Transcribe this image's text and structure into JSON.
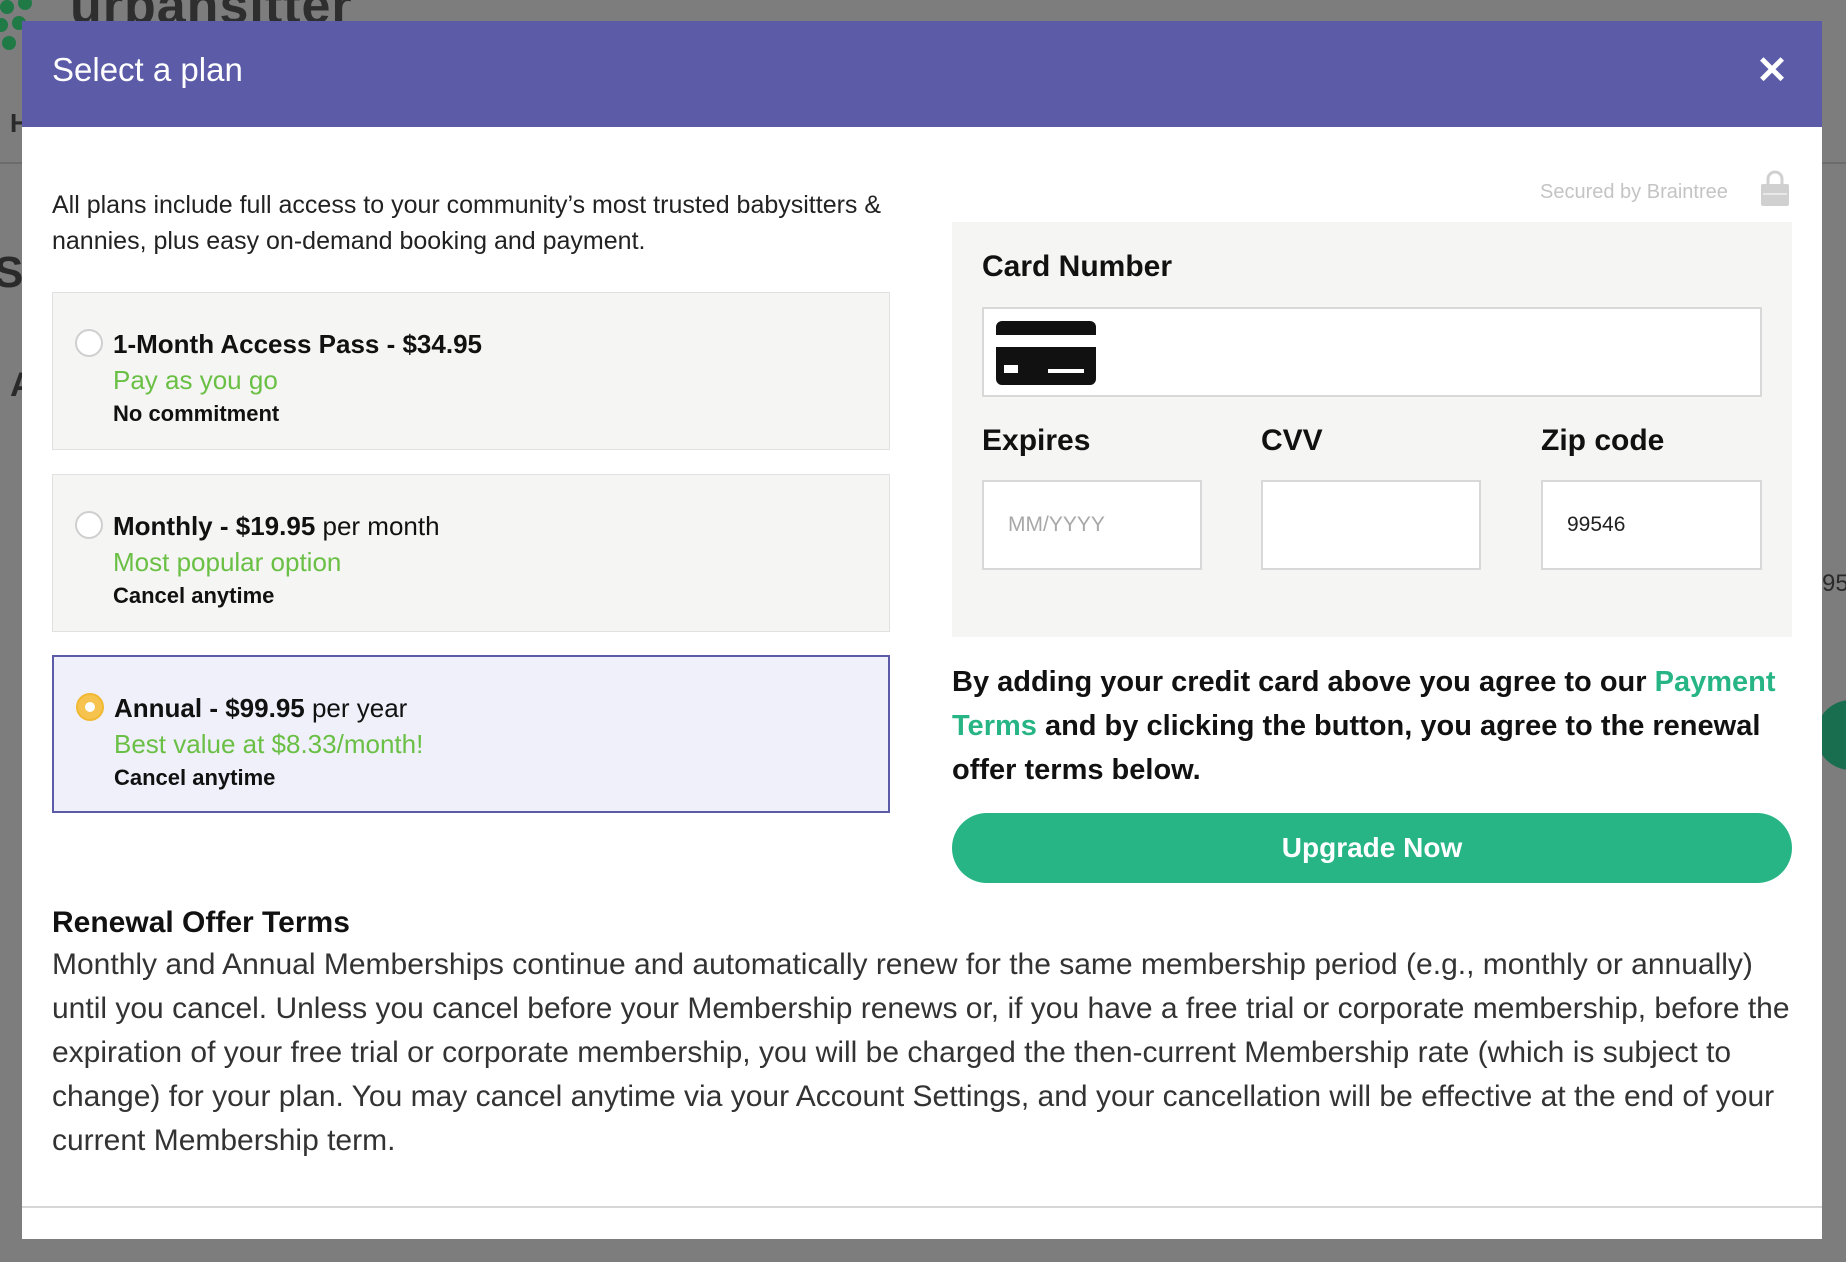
{
  "background": {
    "logo_text": "urbansitter",
    "frag_1": "H",
    "frag_2": "Se",
    "frag_3": "A",
    "frag_4": "95"
  },
  "modal": {
    "title": "Select a plan",
    "close_label": "✕",
    "intro": "All plans include full access to your community’s most trusted babysitters & nannies, plus easy on-demand booking and payment.",
    "plans": [
      {
        "name_bold": "1-Month Access Pass - $34.95",
        "name_rest": "",
        "tag": "Pay as you go",
        "note": "No commitment",
        "selected": false
      },
      {
        "name_bold": "Monthly - $19.95",
        "name_rest": " per month",
        "tag": "Most popular option",
        "note": "Cancel anytime",
        "selected": false
      },
      {
        "name_bold": "Annual - $99.95",
        "name_rest": " per year",
        "tag": "Best value at $8.33/month!",
        "note": "Cancel anytime",
        "selected": true
      }
    ],
    "secured_text": "Secured by Braintree",
    "card": {
      "card_number_label": "Card Number",
      "card_number_value": "",
      "expires_label": "Expires",
      "expires_placeholder": "MM/YYYY",
      "cvv_label": "CVV",
      "cvv_value": "",
      "zip_label": "Zip code",
      "zip_value": "99546"
    },
    "agree": {
      "part1": "By adding your credit card above you agree to our ",
      "link": "Payment Terms",
      "part2": " and by clicking the button, you agree to the renewal offer terms below."
    },
    "upgrade_label": "Upgrade Now",
    "renewal": {
      "title": "Renewal Offer Terms",
      "body": "Monthly and Annual Memberships continue and automatically renew for the same membership period (e.g., monthly or annually) until you cancel. Unless you cancel before your Membership renews or, if you have a free trial or corporate membership, before the expiration of your free trial or corporate membership, you will be charged the then-current Membership rate (which is subject to change) for your plan. You may cancel anytime via your Account Settings, and your cancellation will be effective at the end of your current Membership term."
    }
  },
  "colors": {
    "header": "#5b5ba8",
    "accent_green": "#27b585",
    "tag_green": "#6abf45",
    "radio_selected": "#f6c44e"
  }
}
